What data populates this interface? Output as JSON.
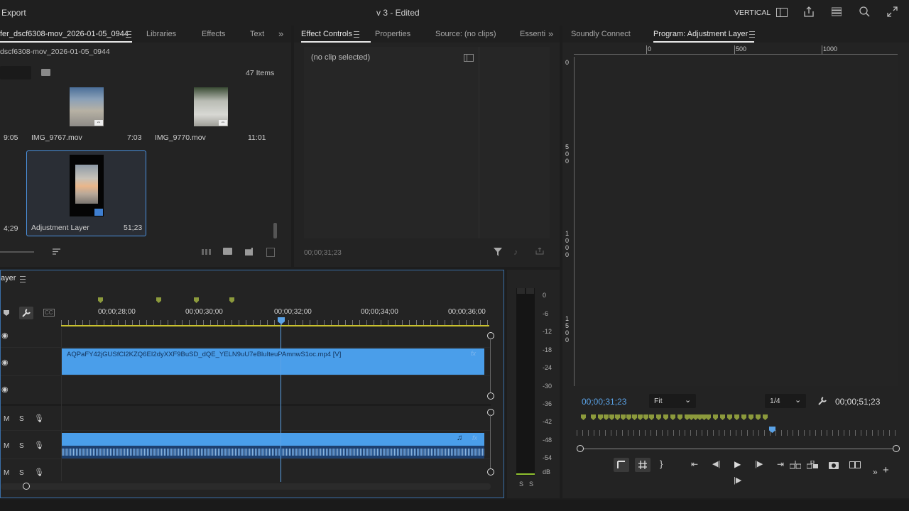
{
  "top": {
    "export": "Export",
    "title": "v 3 - Edited",
    "workspace": "VERTICAL"
  },
  "project": {
    "tabs": [
      "fer_dscf6308-mov_2026-01-05_0944",
      "Libraries",
      "Effects",
      "Text"
    ],
    "bin_path": "dscf6308-mov_2026-01-05_0944",
    "item_count": "47 Items",
    "items": [
      {
        "name": "",
        "duration": "9:05"
      },
      {
        "name": "IMG_9767.mov",
        "duration": "7:03"
      },
      {
        "name": "IMG_9770.mov",
        "duration": "11:01"
      },
      {
        "name": "",
        "duration": "4;29"
      },
      {
        "name": "Adjustment Layer",
        "duration": "51;23"
      }
    ]
  },
  "effect_controls": {
    "tabs": [
      "Effect Controls",
      "Properties",
      "Source: (no clips)",
      "Essenti"
    ],
    "no_clip": "(no clip selected)",
    "timecode": "00;00;31;23"
  },
  "program": {
    "tabs": [
      "Soundly Connect",
      "Program: Adjustment Layer"
    ],
    "ruler_h": [
      "0",
      "500",
      "1000"
    ],
    "ruler_v_0": "0",
    "ruler_v_500": [
      "5",
      "0",
      "0"
    ],
    "ruler_v_1000": [
      "1",
      "0",
      "0",
      "0"
    ],
    "ruler_v_1500": [
      "1",
      "5",
      "0",
      "0"
    ],
    "timecode": "00;00;31;23",
    "fit": "Fit",
    "resolution": "1/4",
    "duration": "00;00;51;23"
  },
  "timeline": {
    "title": "ayer",
    "ruler": [
      "00;00;28;00",
      "00;00;30;00",
      "00;00;32;00",
      "00;00;34;00",
      "00;00;36;00"
    ],
    "clip_name": "AQPaFY42jGUSfCl2KZQ6EI2dyXXF9BuSD_dQE_YELN9uU7eBluIteuPAmnwS1oc.mp4 [V]",
    "fx": "fx",
    "audio_tracks": [
      {
        "m": "M",
        "s": "S"
      },
      {
        "m": "M",
        "s": "S"
      },
      {
        "m": "M",
        "s": "S"
      }
    ],
    "cc": "CC"
  },
  "meter": {
    "labels": [
      "0",
      "-6",
      "-12",
      "-18",
      "-24",
      "-30",
      "-36",
      "-42",
      "-48",
      "-54",
      "dB"
    ],
    "solo": [
      "S",
      "S"
    ]
  },
  "colors": {
    "accent": "#3f95e8",
    "clip": "#4a9eea",
    "marker": "#8c9a3c",
    "timecode": "#5aa2e6"
  }
}
